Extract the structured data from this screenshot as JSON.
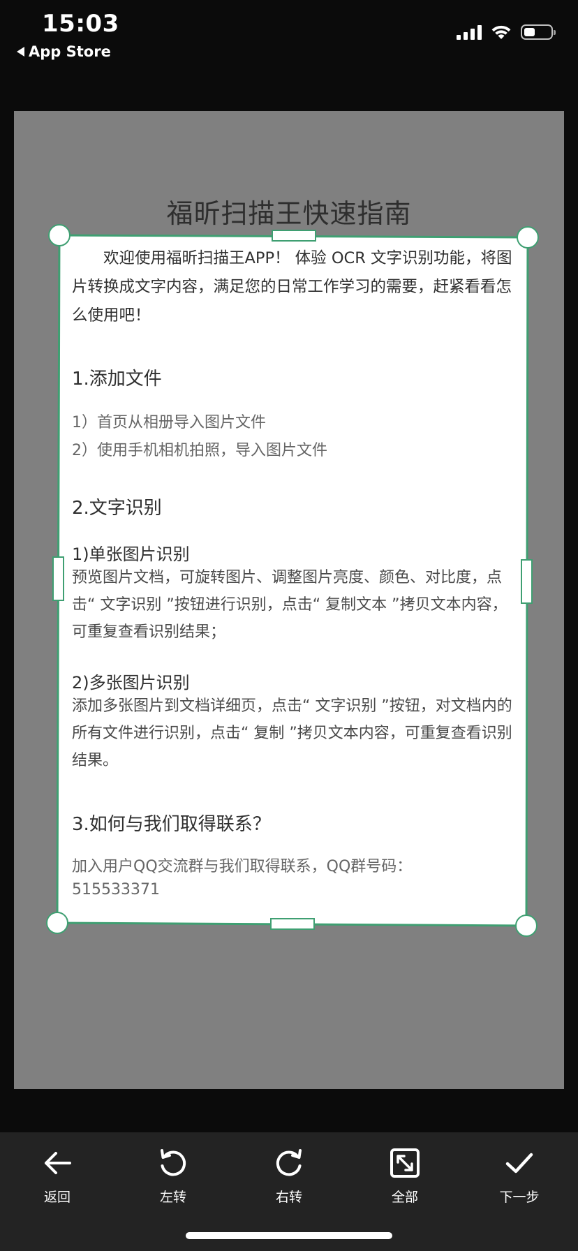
{
  "status_bar": {
    "time": "15:03",
    "back_app": "App Store"
  },
  "document": {
    "title": "福昕扫描王快速指南",
    "intro": "欢迎使用福昕扫描王APP！ 体验 OCR 文字识别功能，将图片转换成文字内容，满足您的日常工作学习的需要，赶紧看看怎么使用吧！",
    "section1": {
      "heading": "1.添加文件",
      "items": [
        "1）首页从相册导入图片文件",
        "2）使用手机相机拍照，导入图片文件"
      ]
    },
    "section2": {
      "heading": "2.文字识别",
      "sub1_heading": "1)单张图片识别",
      "sub1_text": "预览图片文档，可旋转图片、调整图片亮度、颜色、对比度，点击“ 文字识别 ”按钮进行识别，点击“ 复制文本 ”拷贝文本内容，可重复查看识别结果；",
      "sub2_heading": "2)多张图片识别",
      "sub2_text": "添加多张图片到文档详细页，点击“ 文字识别 ”按钮，对文档内的所有文件进行识别，点击“ 复制 ”拷贝文本内容，可重复查看识别结果。"
    },
    "section3": {
      "heading": "3.如何与我们取得联系？",
      "line1": "加入用户QQ交流群与我们取得联系，QQ群号码：",
      "line2": "515533371"
    }
  },
  "toolbar": {
    "back": "返回",
    "rotate_left": "左转",
    "rotate_right": "右转",
    "select_all": "全部",
    "next": "下一步"
  },
  "colors": {
    "crop_frame": "#3f9f72",
    "toolbar_bg": "#232323",
    "image_bg": "#808080"
  }
}
